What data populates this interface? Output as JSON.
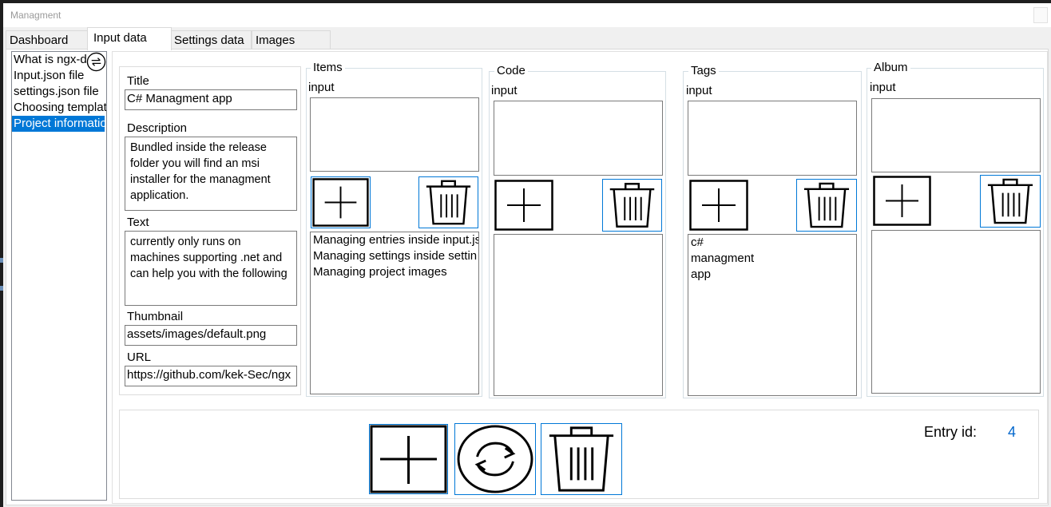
{
  "window": {
    "title": "Managment"
  },
  "tabs": [
    {
      "label": "Dashboard",
      "active": false
    },
    {
      "label": "Input data",
      "active": true
    },
    {
      "label": "Settings data",
      "active": false
    },
    {
      "label": "Images",
      "active": false
    }
  ],
  "entry_list": {
    "items": [
      {
        "label": "What is ngx-d",
        "selected": false
      },
      {
        "label": "Input.json file",
        "selected": false
      },
      {
        "label": "settings.json file",
        "selected": false
      },
      {
        "label": "Choosing templat",
        "selected": false
      },
      {
        "label": "Project informatio",
        "selected": true
      }
    ]
  },
  "form": {
    "title_label": "Title",
    "title_value": "C# Managment app",
    "description_label": "Description",
    "description_value": "Bundled inside the release folder you will find an msi installer for the managment application.",
    "text_label": "Text",
    "text_value": "currently only runs on machines supporting .net and can help you with the following",
    "thumbnail_label": "Thumbnail",
    "thumbnail_value": "assets/images/default.png",
    "url_label": "URL",
    "url_value": "https://github.com/kek-Sec/ngx"
  },
  "groups": {
    "items": {
      "title": "Items",
      "input_label": "input",
      "entries": [
        "Managing entries inside input.js",
        "Managing settings inside settin",
        "Managing project images"
      ]
    },
    "code": {
      "title": "Code",
      "input_label": "input",
      "entries": []
    },
    "tags": {
      "title": "Tags",
      "input_label": "input",
      "entries": [
        "c#",
        "managment",
        "app"
      ]
    },
    "album": {
      "title": "Album",
      "input_label": "input",
      "entries": []
    }
  },
  "footer": {
    "entry_id_label": "Entry id:",
    "entry_id_value": "4"
  },
  "colors": {
    "accent": "#0078d7",
    "entry_id": "#0066cc",
    "selection": "#0078d7"
  }
}
